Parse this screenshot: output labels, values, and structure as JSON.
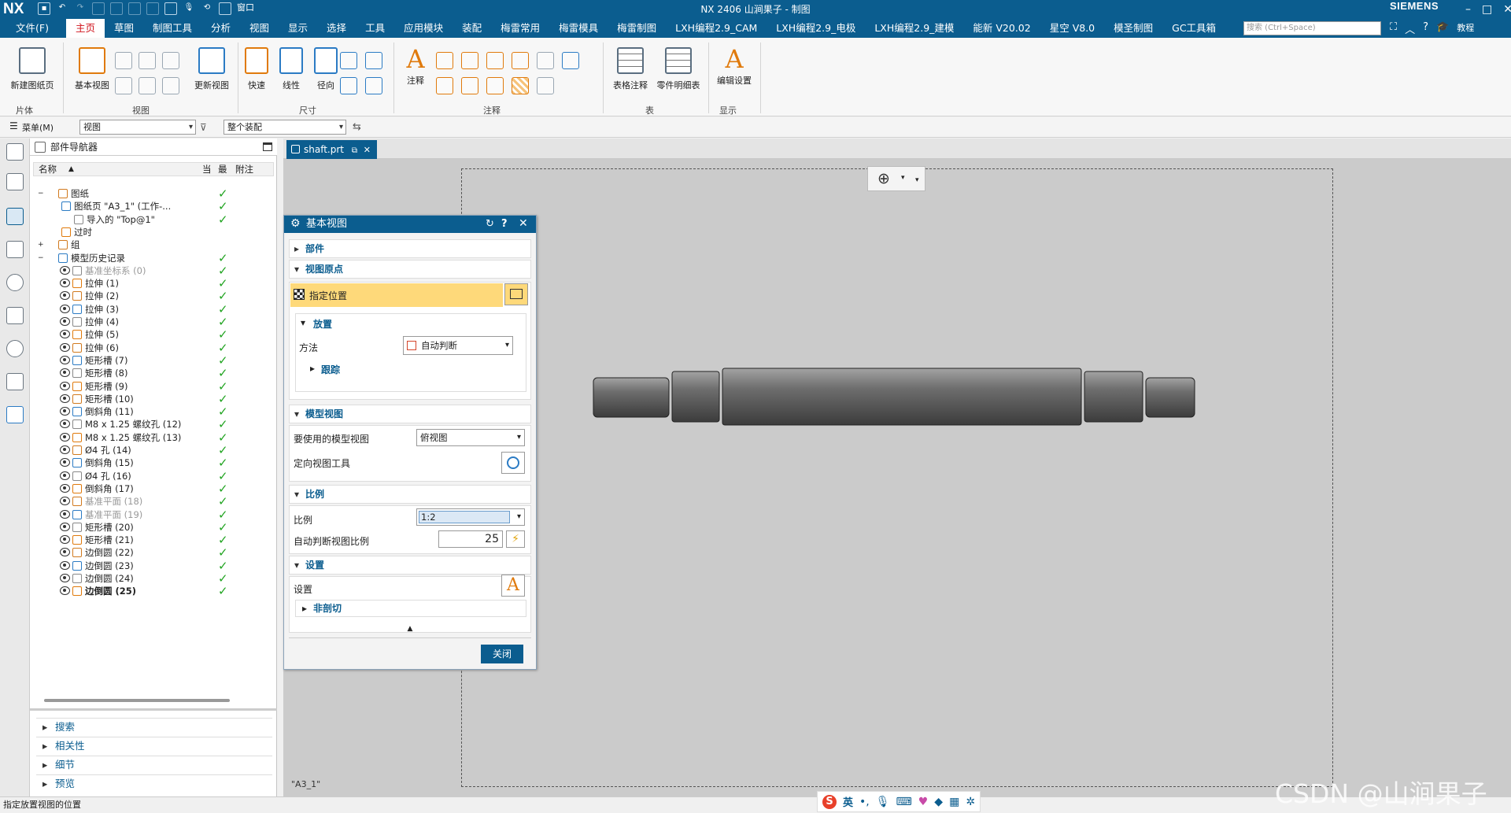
{
  "titlebar": {
    "logo": "NX",
    "title": "NX 2406 山涧果子 - 制图",
    "window_menu": "窗口",
    "brand": "SIEMENS",
    "controls": [
      "–",
      "□",
      "✕"
    ]
  },
  "menubar": {
    "file": "文件(F)",
    "items": [
      "主页",
      "草图",
      "制图工具",
      "分析",
      "视图",
      "显示",
      "选择",
      "工具",
      "应用模块",
      "装配",
      "梅雷常用",
      "梅雷模具",
      "梅雷制图",
      "LXH编程2.9_CAM",
      "LXH编程2.9_电极",
      "LXH编程2.9_建模",
      "能新 V20.02",
      "星空 V8.0",
      "模圣制图",
      "GC工具箱"
    ],
    "active": "主页",
    "search_placeholder": "搜索 (Ctrl+Space)",
    "tutorial": "教程"
  },
  "ribbon": {
    "buttons": {
      "new_sheet": "新建图纸页",
      "base_view": "基本视图",
      "update_view": "更新视图",
      "rapid": "快速",
      "linear": "线性",
      "radial": "径向",
      "note": "注释",
      "table_note": "表格注释",
      "parts_list": "零件明细表",
      "edit_settings": "编辑设置"
    },
    "groups": {
      "sheet": "片体",
      "view": "视图",
      "dimension": "尺寸",
      "annotation": "注释",
      "table": "表",
      "display": "显示"
    }
  },
  "toolbar2": {
    "menu": "菜单(M)",
    "filter": "视图",
    "scope": "整个装配"
  },
  "navigator": {
    "title": "部件导航器",
    "columns": {
      "name": "名称",
      "current": "当",
      "latest": "最",
      "note": "附注"
    },
    "rows": [
      {
        "label": "图纸",
        "indent": 0,
        "check": true
      },
      {
        "label": "图纸页 \"A3_1\" (工作-...",
        "indent": 1,
        "check": true
      },
      {
        "label": "导入的 \"Top@1\"",
        "indent": 2,
        "check": true
      },
      {
        "label": "过时",
        "indent": 1,
        "check": false
      },
      {
        "label": "组",
        "indent": 0,
        "check": false
      },
      {
        "label": "模型历史记录",
        "indent": 0,
        "check": true
      },
      {
        "label": "基准坐标系 (0)",
        "indent": 1,
        "check": true,
        "gray": true
      },
      {
        "label": "拉伸 (1)",
        "indent": 1,
        "check": true
      },
      {
        "label": "拉伸 (2)",
        "indent": 1,
        "check": true
      },
      {
        "label": "拉伸 (3)",
        "indent": 1,
        "check": true
      },
      {
        "label": "拉伸 (4)",
        "indent": 1,
        "check": true
      },
      {
        "label": "拉伸 (5)",
        "indent": 1,
        "check": true
      },
      {
        "label": "拉伸 (6)",
        "indent": 1,
        "check": true
      },
      {
        "label": "矩形槽 (7)",
        "indent": 1,
        "check": true
      },
      {
        "label": "矩形槽 (8)",
        "indent": 1,
        "check": true
      },
      {
        "label": "矩形槽 (9)",
        "indent": 1,
        "check": true
      },
      {
        "label": "矩形槽 (10)",
        "indent": 1,
        "check": true
      },
      {
        "label": "倒斜角 (11)",
        "indent": 1,
        "check": true
      },
      {
        "label": "M8 x 1.25 螺纹孔 (12)",
        "indent": 1,
        "check": true
      },
      {
        "label": "M8 x 1.25 螺纹孔 (13)",
        "indent": 1,
        "check": true
      },
      {
        "label": "Ø4 孔 (14)",
        "indent": 1,
        "check": true
      },
      {
        "label": "倒斜角 (15)",
        "indent": 1,
        "check": true
      },
      {
        "label": "Ø4 孔 (16)",
        "indent": 1,
        "check": true
      },
      {
        "label": "倒斜角 (17)",
        "indent": 1,
        "check": true
      },
      {
        "label": "基准平面 (18)",
        "indent": 1,
        "check": true,
        "gray": true
      },
      {
        "label": "基准平面 (19)",
        "indent": 1,
        "check": true,
        "gray": true
      },
      {
        "label": "矩形槽 (20)",
        "indent": 1,
        "check": true
      },
      {
        "label": "矩形槽 (21)",
        "indent": 1,
        "check": true
      },
      {
        "label": "边倒圆 (22)",
        "indent": 1,
        "check": true
      },
      {
        "label": "边倒圆 (23)",
        "indent": 1,
        "check": true
      },
      {
        "label": "边倒圆 (24)",
        "indent": 1,
        "check": true
      },
      {
        "label": "边倒圆 (25)",
        "indent": 1,
        "check": true,
        "bold": true
      }
    ],
    "bottom_sections": [
      "搜索",
      "相关性",
      "细节",
      "预览"
    ]
  },
  "tab": {
    "label": "shaft.prt"
  },
  "sheet_label": "\"A3_1\"",
  "dialog": {
    "title": "基本视图",
    "sections": {
      "part": "部件",
      "view_origin": "视图原点",
      "placement": "放置",
      "tracking": "跟踪",
      "model_view": "模型视图",
      "scale": "比例",
      "settings": "设置",
      "non_section": "非剖切"
    },
    "specify_location": "指定位置",
    "method_label": "方法",
    "method_value": "自动判断",
    "model_view_label": "要使用的模型视图",
    "model_view_value": "俯视图",
    "orient_tool_label": "定向视图工具",
    "scale_label": "比例",
    "scale_value": "1:2",
    "auto_scale_label": "自动判断视图比例",
    "auto_scale_value": "25",
    "settings_label": "设置",
    "close": "关闭"
  },
  "status": {
    "prompt": "指定放置视图的位置"
  },
  "ime": {
    "lang": "英"
  },
  "watermark": "CSDN @山涧果子"
}
